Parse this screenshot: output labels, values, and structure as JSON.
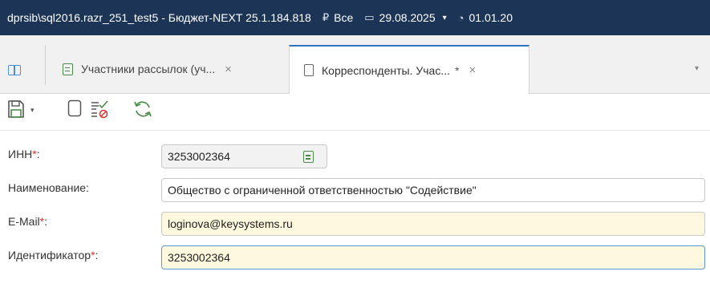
{
  "titlebar": {
    "title": "dprsib\\sql2016.razr_251_test5 - Бюджет-NEXT 25.1.184.818",
    "currency_glyph": "₽",
    "currency_label": "Все",
    "date_glyph": "▭",
    "date_value": "29.08.2025",
    "date_caret": "▾",
    "period_glyph": "◔",
    "period_value": "01.01.20"
  },
  "tabs": [
    {
      "label": "Участники рассылок (уч...",
      "close": "×",
      "active": false
    },
    {
      "label": "Корреспонденты. Учас...",
      "modified": "*",
      "close": "×",
      "active": true
    }
  ],
  "tabs_overflow": "▾",
  "toolbar": {
    "save_caret": "▾"
  },
  "form": {
    "inn": {
      "label": "ИНН",
      "required_mark": "*",
      "colon": ":",
      "value": "3253002364"
    },
    "name": {
      "label": "Наименование:",
      "value": "Общество с ограниченной ответственностью \"Содействие\""
    },
    "email": {
      "label": "E-Mail",
      "required_mark": "*",
      "colon": ":",
      "value": "loginova@keysystems.ru"
    },
    "identifier": {
      "label": "Идентификатор",
      "required_mark": "*",
      "colon": ":",
      "value": "3253002364"
    }
  },
  "colors": {
    "titlebar": "#1c3556",
    "active_tab_accent": "#2d73bf",
    "required_field": "#fdf8de",
    "required_mark": "#d9342b",
    "icon_green": "#4c8c4a"
  }
}
